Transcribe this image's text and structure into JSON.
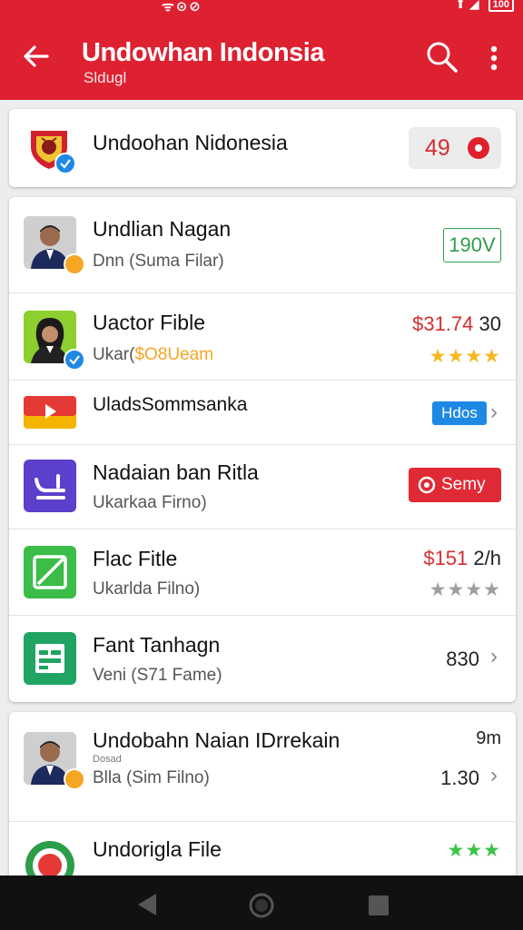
{
  "status": {
    "left": "ᯤ⊙⊘",
    "right": "⬆ ◢",
    "battery": "100"
  },
  "appbar": {
    "title": "Undowhan Indonsia",
    "subtitle": "Sldugl"
  },
  "header_card": {
    "name": "Undoohan Nidonesia",
    "count": "49"
  },
  "rows": [
    {
      "title": "Undlian Nagan",
      "subtitle": "Dnn (Suma Filar)",
      "right": "190V"
    },
    {
      "title": "Uactor Fible",
      "subtitle_a": "Ukar(",
      "subtitle_b": "$O8Ueam",
      "price": "$31.74",
      "suffix": "30",
      "stars": "★★★★"
    },
    {
      "title": "UladsSommsanka",
      "tag": "Hdos"
    },
    {
      "title": "Nadaian ban Ritla",
      "subtitle": "Ukarkaa Firno)",
      "button": "Semy"
    },
    {
      "title": "Flac Fitle",
      "subtitle": "Ukarlda Filno)",
      "price": "$151",
      "suffix": "2/h",
      "stars": "★★★★"
    },
    {
      "title": "Fant Tanhagn",
      "subtitle": "Veni (S71 Fame)",
      "value": "830"
    }
  ],
  "rows2": [
    {
      "title": "Undobahn Naian IDrrekain",
      "tiny": "Dosad",
      "subtitle": "Blla (Sim Filno)",
      "right_top": "9m",
      "right_bottom": "1.30"
    },
    {
      "title": "Undorigla File",
      "stars": "★★★"
    }
  ],
  "colors": {
    "accent": "#dd2131",
    "green": "#2e9d4b",
    "blue": "#1e88e5",
    "star_gold": "#f5b820"
  }
}
